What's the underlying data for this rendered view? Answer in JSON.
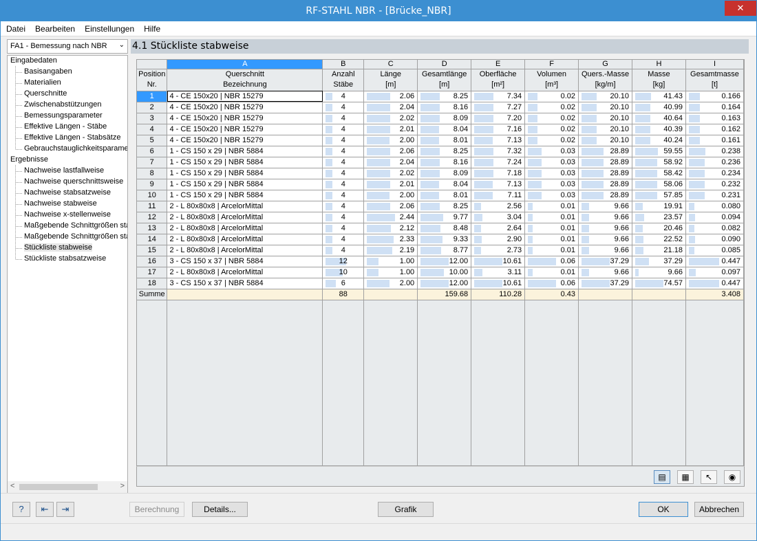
{
  "window": {
    "title": "RF-STAHL NBR - [Brücke_NBR]",
    "close": "✕"
  },
  "menu": [
    "Datei",
    "Bearbeiten",
    "Einstellungen",
    "Hilfe"
  ],
  "case_select": "FA1 - Bemessung nach NBR",
  "nav": {
    "input_group": "Eingabedaten",
    "input_items": [
      "Basisangaben",
      "Materialien",
      "Querschnitte",
      "Zwischenabstützungen",
      "Bemessungsparameter",
      "Effektive Längen - Stäbe",
      "Effektive Längen - Stabsätze",
      "Gebrauchstauglichkeitsparamet"
    ],
    "results_group": "Ergebnisse",
    "results_items": [
      "Nachweise lastfallweise",
      "Nachweise querschnittsweise",
      "Nachweise stabsatzweise",
      "Nachweise stabweise",
      "Nachweise x-stellenweise",
      "Maßgebende Schnittgrößen sta",
      "Maßgebende Schnittgrößen sta",
      "Stückliste stabweise",
      "Stückliste stabsatzweise"
    ],
    "selected": "Stückliste stabweise"
  },
  "section_title": "4.1 Stückliste stabweise",
  "table": {
    "letters": [
      "A",
      "B",
      "C",
      "D",
      "E",
      "F",
      "G",
      "H",
      "I"
    ],
    "pos_header": [
      "Position",
      "Nr."
    ],
    "headers": [
      [
        "Querschnitt",
        "Bezeichnung"
      ],
      [
        "Anzahl",
        "Stäbe"
      ],
      [
        "Länge",
        "[m]"
      ],
      [
        "Gesamtlänge",
        "[m]"
      ],
      [
        "Oberfläche",
        "[m²]"
      ],
      [
        "Volumen",
        "[m³]"
      ],
      [
        "Quers.-Masse",
        "[kg/m]"
      ],
      [
        "Masse",
        "[kg]"
      ],
      [
        "Gesamtmasse",
        "[t]"
      ]
    ],
    "rows": [
      [
        "1",
        "4 - CE 150x20 | NBR 15279",
        "4",
        "2.06",
        "8.25",
        "7.34",
        "0.02",
        "20.10",
        "41.43",
        "0.166"
      ],
      [
        "2",
        "4 - CE 150x20 | NBR 15279",
        "4",
        "2.04",
        "8.16",
        "7.27",
        "0.02",
        "20.10",
        "40.99",
        "0.164"
      ],
      [
        "3",
        "4 - CE 150x20 | NBR 15279",
        "4",
        "2.02",
        "8.09",
        "7.20",
        "0.02",
        "20.10",
        "40.64",
        "0.163"
      ],
      [
        "4",
        "4 - CE 150x20 | NBR 15279",
        "4",
        "2.01",
        "8.04",
        "7.16",
        "0.02",
        "20.10",
        "40.39",
        "0.162"
      ],
      [
        "5",
        "4 - CE 150x20 | NBR 15279",
        "4",
        "2.00",
        "8.01",
        "7.13",
        "0.02",
        "20.10",
        "40.24",
        "0.161"
      ],
      [
        "6",
        "1 - CS 150 x 29 | NBR 5884",
        "4",
        "2.06",
        "8.25",
        "7.32",
        "0.03",
        "28.89",
        "59.55",
        "0.238"
      ],
      [
        "7",
        "1 - CS 150 x 29 | NBR 5884",
        "4",
        "2.04",
        "8.16",
        "7.24",
        "0.03",
        "28.89",
        "58.92",
        "0.236"
      ],
      [
        "8",
        "1 - CS 150 x 29 | NBR 5884",
        "4",
        "2.02",
        "8.09",
        "7.18",
        "0.03",
        "28.89",
        "58.42",
        "0.234"
      ],
      [
        "9",
        "1 - CS 150 x 29 | NBR 5884",
        "4",
        "2.01",
        "8.04",
        "7.13",
        "0.03",
        "28.89",
        "58.06",
        "0.232"
      ],
      [
        "10",
        "1 - CS 150 x 29 | NBR 5884",
        "4",
        "2.00",
        "8.01",
        "7.11",
        "0.03",
        "28.89",
        "57.85",
        "0.231"
      ],
      [
        "11",
        "2 - L 80x80x8 | ArcelorMittal",
        "4",
        "2.06",
        "8.25",
        "2.56",
        "0.01",
        "9.66",
        "19.91",
        "0.080"
      ],
      [
        "12",
        "2 - L 80x80x8 | ArcelorMittal",
        "4",
        "2.44",
        "9.77",
        "3.04",
        "0.01",
        "9.66",
        "23.57",
        "0.094"
      ],
      [
        "13",
        "2 - L 80x80x8 | ArcelorMittal",
        "4",
        "2.12",
        "8.48",
        "2.64",
        "0.01",
        "9.66",
        "20.46",
        "0.082"
      ],
      [
        "14",
        "2 - L 80x80x8 | ArcelorMittal",
        "4",
        "2.33",
        "9.33",
        "2.90",
        "0.01",
        "9.66",
        "22.52",
        "0.090"
      ],
      [
        "15",
        "2 - L 80x80x8 | ArcelorMittal",
        "4",
        "2.19",
        "8.77",
        "2.73",
        "0.01",
        "9.66",
        "21.18",
        "0.085"
      ],
      [
        "16",
        "3 - CS 150 x 37 | NBR 5884",
        "12",
        "1.00",
        "12.00",
        "10.61",
        "0.06",
        "37.29",
        "37.29",
        "0.447"
      ],
      [
        "17",
        "2 - L 80x80x8 | ArcelorMittal",
        "10",
        "1.00",
        "10.00",
        "3.11",
        "0.01",
        "9.66",
        "9.66",
        "0.097"
      ],
      [
        "18",
        "3 - CS 150 x 37 | NBR 5884",
        "6",
        "2.00",
        "12.00",
        "10.61",
        "0.06",
        "37.29",
        "74.57",
        "0.447"
      ]
    ],
    "sum": [
      "Summe",
      "",
      "88",
      "",
      "159.68",
      "110.28",
      "0.43",
      "",
      "",
      "3.408"
    ]
  },
  "toolbar_icons": [
    "table-filter-icon",
    "excel-export-icon",
    "pointer-select-icon",
    "eye-icon"
  ],
  "footer": {
    "calc_label": "Berechnung",
    "details_label": "Details...",
    "graphic_label": "Grafik",
    "ok_label": "OK",
    "cancel_label": "Abbrechen"
  }
}
